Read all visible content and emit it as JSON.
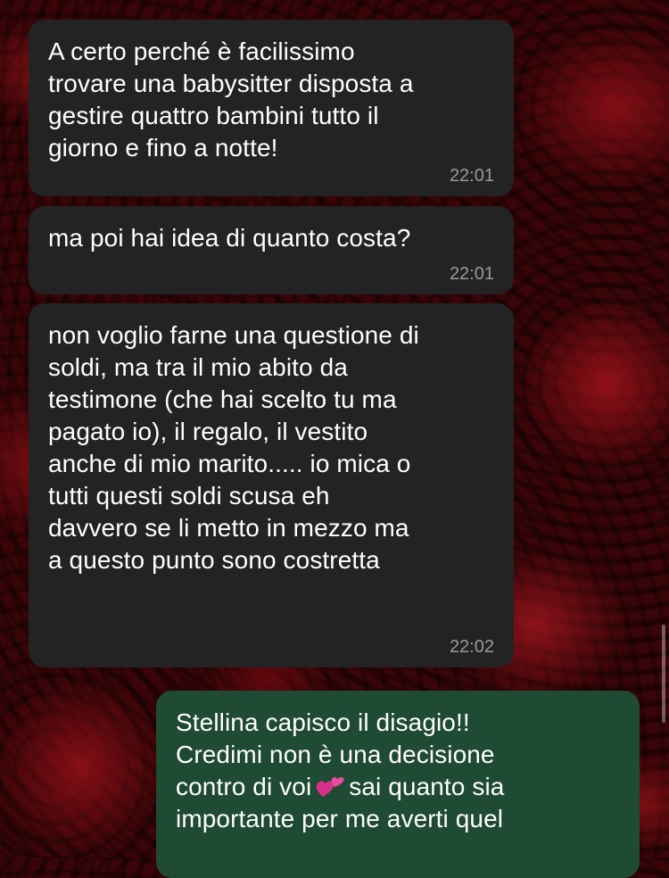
{
  "messages": [
    {
      "direction": "incoming",
      "text": "A  certo perché è facilissimo\ntrovare una babysitter disposta a\ngestire quattro bambini tutto il\ngiorno e fino a notte!",
      "time": "22:01"
    },
    {
      "direction": "incoming",
      "text": "ma poi hai idea di quanto costa?",
      "time": "22:01"
    },
    {
      "direction": "incoming",
      "text": "non voglio farne una questione di\nsoldi, ma tra il mio abito da\ntestimone (che hai scelto tu ma\npagato io), il regalo, il vestito\nanche di mio marito..... io mica o\ntutti questi soldi scusa eh\ndavvero se li metto in mezzo ma\na questo punto sono costretta",
      "time": "22:02"
    },
    {
      "direction": "outgoing",
      "text_line1": "Stellina capisco il disagio!!",
      "text_line2": "Credimi non è una decisione",
      "text_line3_before_emoji": "contro di voi",
      "emoji": "two-hearts-icon",
      "text_line3_after_emoji": "sai quanto sia",
      "text_line4": "importante per me averti quel"
    }
  ],
  "colors": {
    "incoming_bubble": "#232323",
    "outgoing_bubble": "#1f4a33",
    "text": "#ffffff",
    "timestamp": "#9a9a9a",
    "wallpaper": "#3a0508"
  }
}
